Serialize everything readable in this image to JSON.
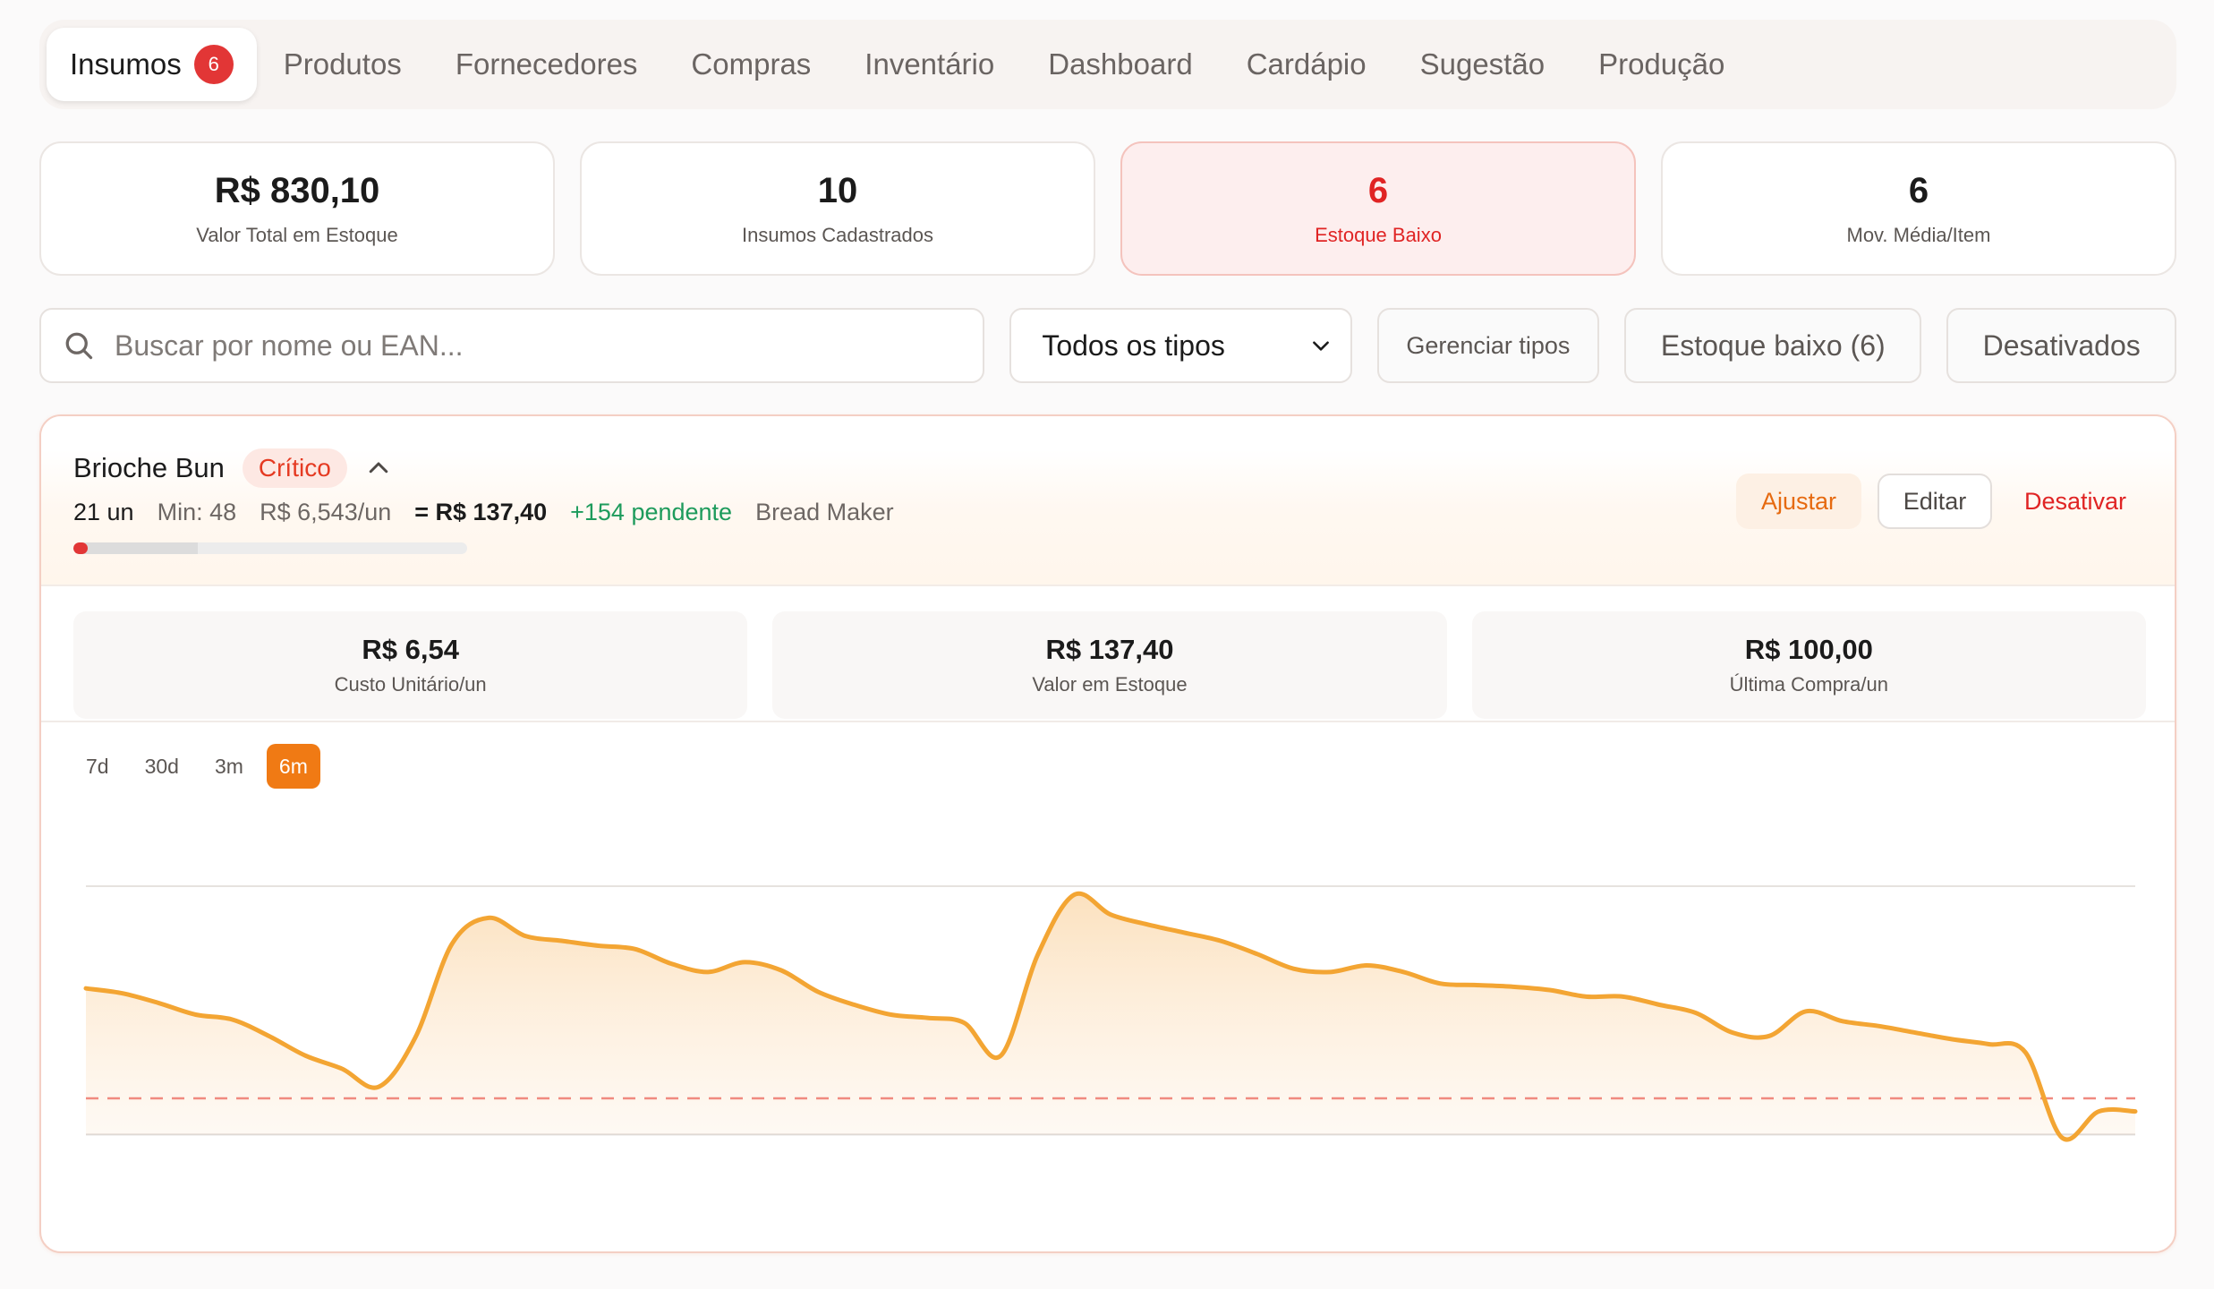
{
  "tabs": [
    {
      "label": "Insumos",
      "badge": "6",
      "active": true
    },
    {
      "label": "Produtos"
    },
    {
      "label": "Fornecedores"
    },
    {
      "label": "Compras"
    },
    {
      "label": "Inventário"
    },
    {
      "label": "Dashboard"
    },
    {
      "label": "Cardápio"
    },
    {
      "label": "Sugestão"
    },
    {
      "label": "Produção"
    }
  ],
  "stats": [
    {
      "value": "R$ 830,10",
      "label": "Valor Total em Estoque"
    },
    {
      "value": "10",
      "label": "Insumos Cadastrados"
    },
    {
      "value": "6",
      "label": "Estoque Baixo",
      "alert": true
    },
    {
      "value": "6",
      "label": "Mov. Média/Item"
    }
  ],
  "filters": {
    "search_placeholder": "Buscar por nome ou EAN...",
    "type_select": "Todos os tipos",
    "manage_types": "Gerenciar tipos",
    "low_stock": "Estoque baixo (6)",
    "deactivated": "Desativados"
  },
  "item": {
    "name": "Brioche Bun",
    "status": "Crítico",
    "qty": "21 un",
    "min": "Min: 48",
    "unit_cost": "R$ 6,543/un",
    "total": "= R$ 137,40",
    "pending": "+154 pendente",
    "supplier": "Bread Maker",
    "stock_level_fraction": 0.035,
    "actions": {
      "adjust": "Ajustar",
      "edit": "Editar",
      "deactivate": "Desativar"
    },
    "metrics": [
      {
        "value": "R$ 6,54",
        "label": "Custo Unitário/un"
      },
      {
        "value": "R$ 137,40",
        "label": "Valor em Estoque"
      },
      {
        "value": "R$ 100,00",
        "label": "Última Compra/un"
      }
    ],
    "ranges": [
      "7d",
      "30d",
      "3m",
      "6m"
    ],
    "active_range": "6m"
  },
  "colors": {
    "accent": "#f07a14",
    "danger": "#e23636",
    "success": "#1d9b5c",
    "line": "#f3a533"
  },
  "icons": {
    "search": "search-icon",
    "select": "chevron-down-icon",
    "collapse": "chevron-up-icon"
  },
  "chart_data": {
    "type": "area",
    "title": "",
    "xlabel": "",
    "ylabel": "",
    "ylim": [
      0,
      180
    ],
    "min_line": 48,
    "grid": true,
    "series": [
      {
        "values": [
          115,
          112,
          106,
          99,
          96,
          86,
          74,
          66,
          55,
          85,
          142,
          158,
          147,
          144,
          141,
          139,
          130,
          125,
          131,
          126,
          113,
          105,
          99,
          97,
          94,
          74,
          135,
          172,
          160,
          154,
          149,
          144,
          136,
          127,
          125,
          129,
          125,
          118,
          117,
          116,
          114,
          110,
          110,
          105,
          100,
          88,
          86,
          101,
          95,
          92,
          88,
          84,
          81,
          76,
          24,
          40,
          40
        ]
      }
    ]
  }
}
